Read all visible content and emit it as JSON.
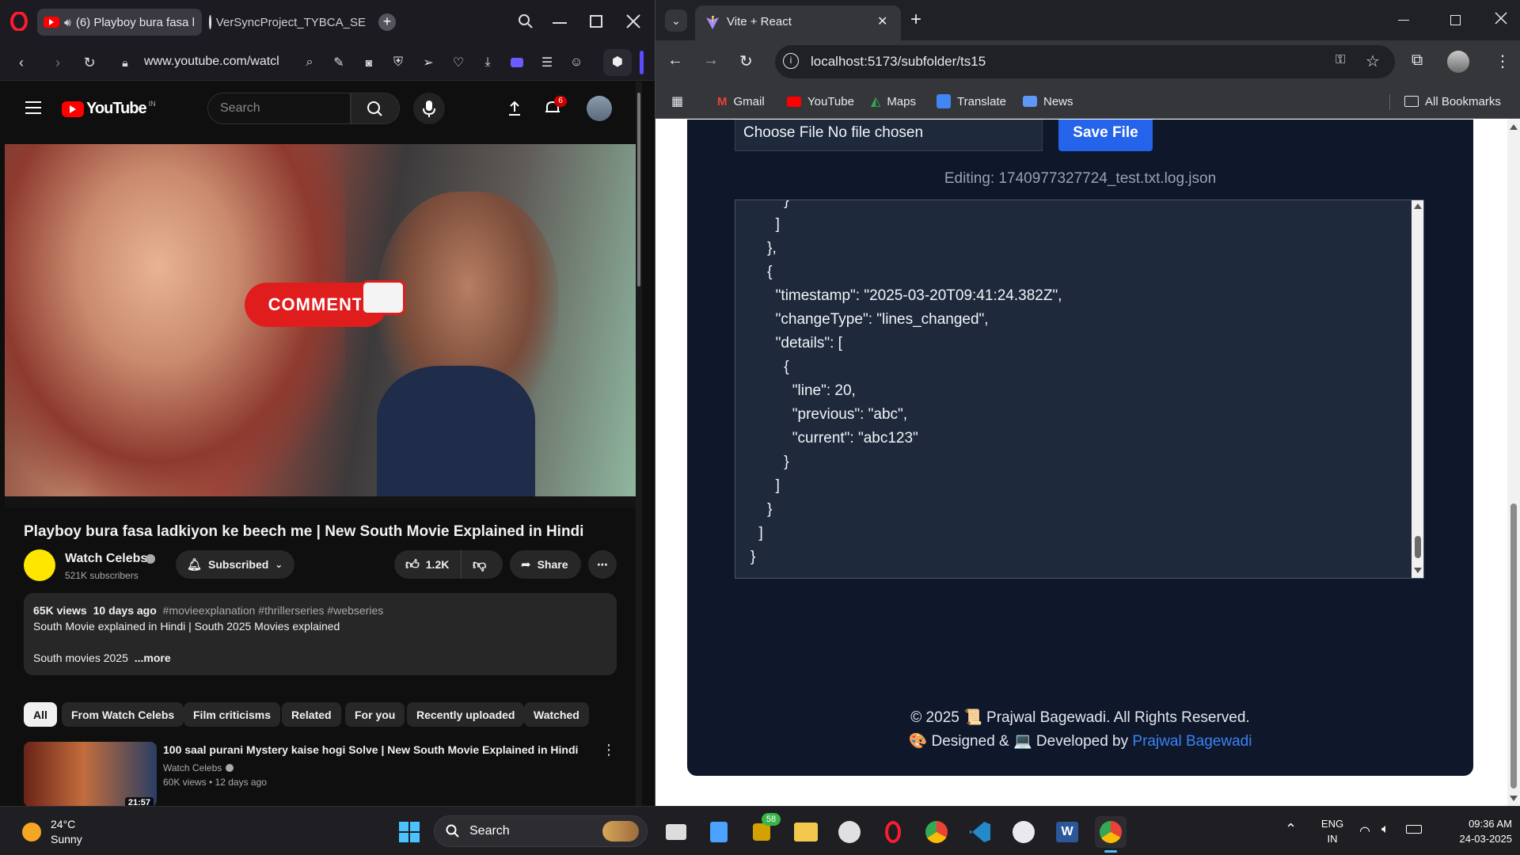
{
  "opera": {
    "tabs": [
      {
        "label": "(6) Playboy bura fasa l"
      },
      {
        "label": "VerSyncProject_TYBCA_SE"
      }
    ],
    "url": "www.youtube.com/watcl"
  },
  "youtube": {
    "logo_text": "YouTube",
    "region": "IN",
    "search_placeholder": "Search",
    "notification_count": "6",
    "thumbnail_overlay_text": "COMMENT",
    "video_title": "Playboy bura fasa ladkiyon ke beech me | New South Movie Explained in Hindi",
    "channel": {
      "name": "Watch Celebs",
      "subscribers": "521K subscribers",
      "verified": true
    },
    "subscribed_label": "Subscribed",
    "likes": "1.2K",
    "share_label": "Share",
    "description": {
      "views": "65K views",
      "age": "10 days ago",
      "hashtags": "#movieexplanation #thrillerseries #webseries",
      "line1": "South Movie explained in Hindi | South 2025 Movies explained",
      "line2": "South movies 2025",
      "more": "...more"
    },
    "chips": [
      "All",
      "From Watch Celebs",
      "Film criticisms",
      "Related",
      "For you",
      "Recently uploaded",
      "Watched"
    ],
    "recommended": [
      {
        "title": "100 saal purani Mystery kaise hogi Solve | New South Movie Explained in Hindi",
        "channel": "Watch Celebs",
        "meta": "60K views • 12 days ago",
        "duration": "21:57"
      }
    ]
  },
  "chrome": {
    "tab_title": "Vite + React",
    "url": "localhost:5173/subfolder/ts15",
    "bookmarks": [
      "Gmail",
      "YouTube",
      "Maps",
      "Translate",
      "News"
    ],
    "all_bookmarks": "All Bookmarks"
  },
  "app": {
    "file_input_text": "Choose File No file chosen",
    "save_button": "Save File",
    "editing_label": "Editing: 1740977327724_test.txt.log.json",
    "editor_content": "        }\n      ]\n    },\n    {\n      \"timestamp\": \"2025-03-20T09:41:24.382Z\",\n      \"changeType\": \"lines_changed\",\n      \"details\": [\n        {\n          \"line\": 20,\n          \"previous\": \"abc\",\n          \"current\": \"abc123\"\n        }\n      ]\n    }\n  ]\n}",
    "footer_line1": "© 2025 📜 Prajwal Bagewadi. All Rights Reserved.",
    "footer_line2_prefix": "🎨 Designed & 💻 Developed by",
    "footer_link": "Prajwal Bagewadi"
  },
  "taskbar": {
    "weather_temp": "24°C",
    "weather_desc": "Sunny",
    "search_label": "Search",
    "badge_count": "58",
    "language_line1": "ENG",
    "language_line2": "IN",
    "time": "09:36 AM",
    "date": "24-03-2025"
  },
  "colors": {
    "youtube_red": "#ff0000",
    "save_button": "#2563eb",
    "footer_link": "#3b82f6",
    "app_card": "#0f172a",
    "editor_bg": "#1e293b"
  }
}
